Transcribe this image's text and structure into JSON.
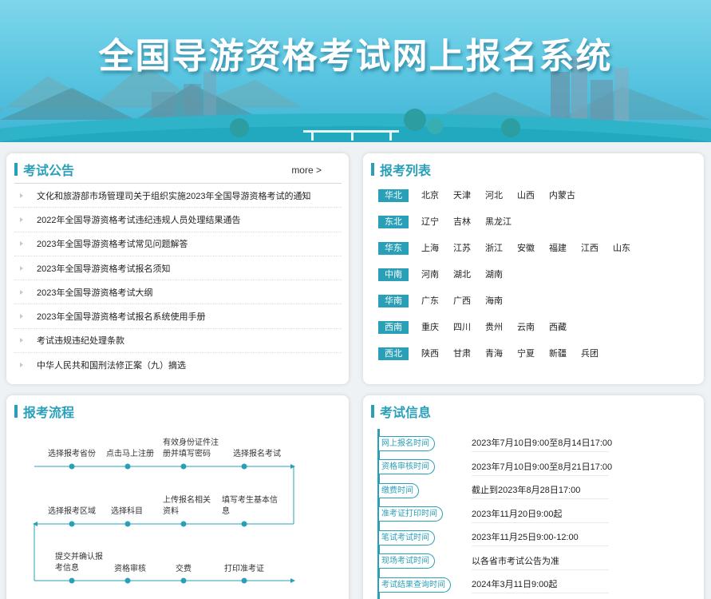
{
  "banner": {
    "title": "全国导游资格考试网上报名系统"
  },
  "notice": {
    "title": "考试公告",
    "more": "more >",
    "items": [
      "文化和旅游部市场管理司关于组织实施2023年全国导游资格考试的通知",
      "2022年全国导游资格考试违纪违规人员处理结果通告",
      "2023年全国导游资格考试常见问题解答",
      "2023年全国导游资格考试报名须知",
      "2023年全国导游资格考试大纲",
      "2023年全国导游资格考试报名系统使用手册",
      "考试违规违纪处理条款",
      "中华人民共和国刑法修正案（九）摘选"
    ]
  },
  "regions": {
    "title": "报考列表",
    "rows": [
      {
        "tag": "华北",
        "provinces": [
          "北京",
          "天津",
          "河北",
          "山西",
          "内蒙古"
        ]
      },
      {
        "tag": "东北",
        "provinces": [
          "辽宁",
          "吉林",
          "黑龙江"
        ]
      },
      {
        "tag": "华东",
        "provinces": [
          "上海",
          "江苏",
          "浙江",
          "安徽",
          "福建",
          "江西",
          "山东"
        ]
      },
      {
        "tag": "中南",
        "provinces": [
          "河南",
          "湖北",
          "湖南"
        ]
      },
      {
        "tag": "华南",
        "provinces": [
          "广东",
          "广西",
          "海南"
        ]
      },
      {
        "tag": "西南",
        "provinces": [
          "重庆",
          "四川",
          "贵州",
          "云南",
          "西藏"
        ]
      },
      {
        "tag": "西北",
        "provinces": [
          "陕西",
          "甘肃",
          "青海",
          "宁夏",
          "新疆",
          "兵团"
        ]
      }
    ]
  },
  "flow": {
    "title": "报考流程",
    "steps": [
      "选择报考省份",
      "点击马上注册",
      "有效身份证件注册并填写密码",
      "选择报名考试",
      "填写考生基本信息",
      "上传报名相关资料",
      "选择科目",
      "选择报考区域",
      "提交并确认报考信息",
      "资格审核",
      "交费",
      "打印准考证"
    ]
  },
  "exam_info": {
    "title": "考试信息",
    "items": [
      {
        "label": "网上报名时间",
        "value": "2023年7月10日9:00至8月14日17:00"
      },
      {
        "label": "资格审核时间",
        "value": "2023年7月10日9:00至8月21日17:00"
      },
      {
        "label": "缴费时间",
        "value": "截止到2023年8月28日17:00"
      },
      {
        "label": "准考证打印时间",
        "value": "2023年11月20日9:00起"
      },
      {
        "label": "笔试考试时间",
        "value": "2023年11月25日9:00-12:00"
      },
      {
        "label": "现场考试时间",
        "value": "以各省市考试公告为准"
      },
      {
        "label": "考试结果查询时间",
        "value": "2024年3月11日9:00起"
      }
    ]
  },
  "colors": {
    "accent": "#2a9fb8",
    "banner_sky": "#5ec8e2"
  }
}
